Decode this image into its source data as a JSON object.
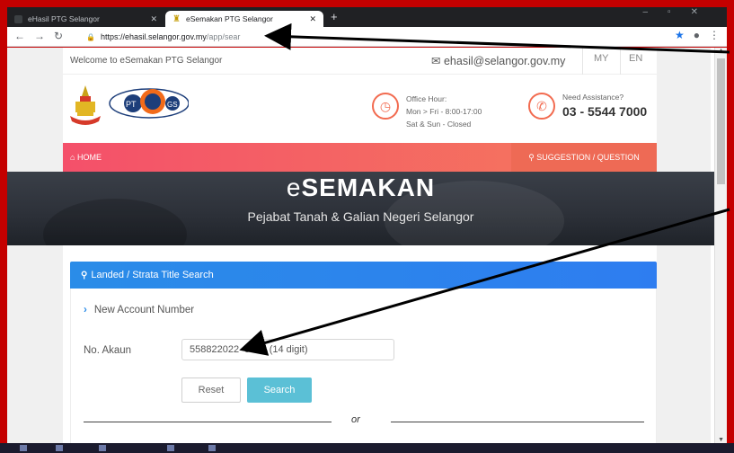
{
  "browser": {
    "tabs": [
      {
        "title": "eHasil PTG Selangor",
        "active": false
      },
      {
        "title": "eSemakan PTG Selangor",
        "active": true
      }
    ],
    "url_host": "https://ehasil.selangor.gov.my",
    "url_path": "/app/sear"
  },
  "topline": {
    "welcome": "Welcome to eSemakan PTG Selangor",
    "email": "ehasil@selangor.gov.my",
    "lang_my": "MY",
    "lang_en": "EN"
  },
  "brand": {
    "office_hour_label": "Office Hour:",
    "office_hour_weekday": "Mon > Fri - 8:00-17:00",
    "office_hour_weekend": "Sat & Sun - Closed",
    "assist_label": "Need Assistance?",
    "assist_phone": "03 - 5544 7000"
  },
  "nav": {
    "home": "HOME",
    "suggestion": "SUGGESTION / QUESTION"
  },
  "hero": {
    "title_prefix": "e",
    "title_main": "SEMAKAN",
    "subtitle": "Pejabat Tanah & Galian Negeri Selangor"
  },
  "search_panel": {
    "heading": "Landed / Strata Title Search",
    "section": "New Account Number",
    "field_label": "No. Akaun",
    "field_value": "558822022  5531 (14 digit)",
    "reset_label": "Reset",
    "search_label": "Search",
    "divider_text": "or"
  },
  "colors": {
    "nav_gradient_start": "#f4506a",
    "nav_gradient_end": "#f57b5c",
    "panel_blue": "#2a8ce8",
    "search_button": "#5bc0d6",
    "frame_red": "#c40000"
  }
}
